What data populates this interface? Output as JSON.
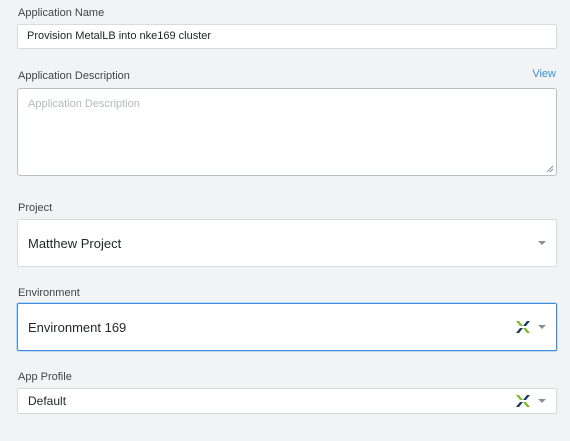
{
  "app_name": {
    "label": "Application Name",
    "value": "Provision MetalLB into nke169 cluster"
  },
  "app_description": {
    "label": "Application Description",
    "view_link": "View",
    "placeholder": "Application Description",
    "value": ""
  },
  "project": {
    "label": "Project",
    "selected": "Matthew Project"
  },
  "environment": {
    "label": "Environment",
    "selected": "Environment 169",
    "icon": "nutanix-logo-icon"
  },
  "app_profile": {
    "label": "App Profile",
    "selected": "Default",
    "icon": "nutanix-logo-icon"
  },
  "colors": {
    "accent": "#3d8ee0",
    "link": "#3a8fd8",
    "logo_green": "#7cbb2a",
    "logo_navy": "#1c3a63"
  }
}
